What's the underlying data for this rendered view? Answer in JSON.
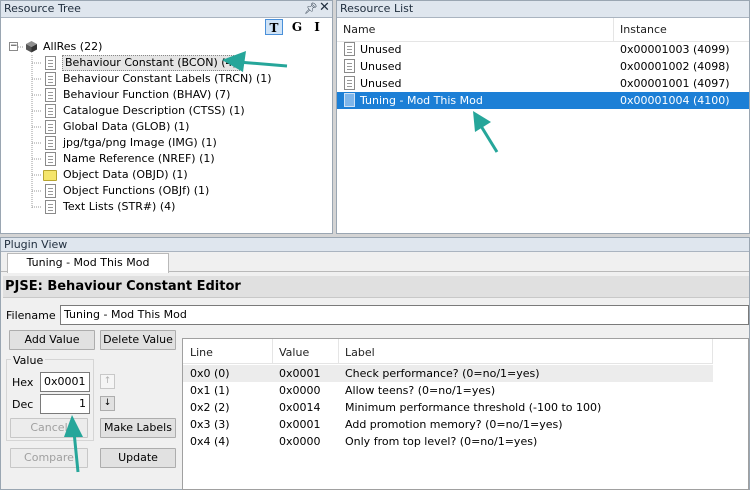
{
  "resource_tree": {
    "title": "Resource Tree",
    "toolbar": {
      "t": "T",
      "g": "G",
      "i": "I"
    },
    "root": "AllRes (22)",
    "items": [
      {
        "label": "Behaviour Constant (BCON) (4)"
      },
      {
        "label": "Behaviour Constant Labels (TRCN) (1)"
      },
      {
        "label": "Behaviour Function (BHAV) (7)"
      },
      {
        "label": "Catalogue Description (CTSS) (1)"
      },
      {
        "label": "Global Data (GLOB) (1)"
      },
      {
        "label": "jpg/tga/png Image (IMG) (1)"
      },
      {
        "label": "Name Reference (NREF) (1)"
      },
      {
        "label": "Object Data (OBJD) (1)"
      },
      {
        "label": "Object Functions (OBJf) (1)"
      },
      {
        "label": "Text Lists (STR#) (4)"
      }
    ]
  },
  "resource_list": {
    "title": "Resource List",
    "col_name": "Name",
    "col_instance": "Instance",
    "rows": [
      {
        "name": "Unused",
        "instance": "0x00001003 (4099)"
      },
      {
        "name": "Unused",
        "instance": "0x00001002 (4098)"
      },
      {
        "name": "Unused",
        "instance": "0x00001001 (4097)"
      },
      {
        "name": "Tuning - Mod This Mod",
        "instance": "0x00001004 (4100)"
      }
    ]
  },
  "plugin_view": {
    "title": "Plugin View",
    "tab": "Tuning - Mod This Mod",
    "editor_title": "PJSE: Behaviour Constant Editor",
    "filename_label": "Filename",
    "filename_value": "Tuning - Mod This Mod",
    "add_value": "Add Value",
    "delete_value": "Delete Value",
    "value_group": "Value",
    "hex_label": "Hex",
    "hex_value": "0x0001",
    "dec_label": "Dec",
    "dec_value": "1",
    "cancel": "Cancel",
    "make_labels": "Make Labels",
    "compare": "Compare",
    "update": "Update",
    "table": {
      "col_line": "Line",
      "col_value": "Value",
      "col_label": "Label",
      "rows": [
        {
          "line": "0x0 (0)",
          "value": "0x0001",
          "label": "Check performance? (0=no/1=yes)"
        },
        {
          "line": "0x1 (1)",
          "value": "0x0000",
          "label": "Allow teens? (0=no/1=yes)"
        },
        {
          "line": "0x2 (2)",
          "value": "0x0014",
          "label": "Minimum performance threshold (-100 to 100)"
        },
        {
          "line": "0x3 (3)",
          "value": "0x0001",
          "label": "Add promotion memory? (0=no/1=yes)"
        },
        {
          "line": "0x4 (4)",
          "value": "0x0000",
          "label": "Only from top level? (0=no/1=yes)"
        }
      ]
    }
  },
  "colors": {
    "accent_arrow": "#26a69a",
    "selection": "#1c7fd6"
  }
}
